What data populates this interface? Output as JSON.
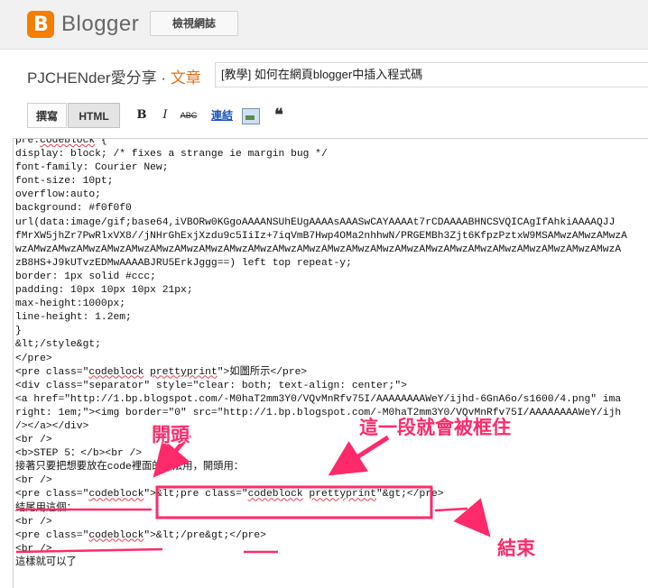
{
  "header": {
    "logo_letter": "B",
    "logo_text": "Blogger",
    "view_blog_label": "檢視網誌"
  },
  "blog": {
    "name": "PJCHENder愛分享",
    "separator": " · ",
    "section": "文章"
  },
  "post": {
    "title_value": "[教學] 如何在網頁blogger中插入程式碼"
  },
  "toolbar": {
    "compose_label": "撰寫",
    "html_label": "HTML",
    "bold_label": "B",
    "italic_label": "I",
    "strike_label": "ABC",
    "link_label": "連結",
    "quote_label": "❝"
  },
  "editor": {
    "lines": [
      "pre.codeblock {",
      "display: block; /* fixes a strange ie margin bug */",
      "font-family: Courier New;",
      "font-size: 10pt;",
      "overflow:auto;",
      "background: #f0f0f0",
      "url(data:image/gif;base64,iVBORw0KGgoAAAANSUhEUgAAAAsAAASwCAYAAAAt7rCDAAAABHNCSVQICAgIfAhkiAAAAQJJ",
      "fMrXW5jhZr7PwRlxVX8//jNHrGhExjXzdu9c5IiIz+7iqVmB7Hwp4OMa2nhhwN/PRGEMBh3Zjt6KfpzPztxW9MSAMwzAMwzAMwzA",
      "wzAMwzAMwzAMwzAMwzAMwzAMwzAMwzAMwzAMwzAMwzAMwzAMwzAMwzAMwzAMwzAMwzAMwzAMwzAMwzAMwzAMwzAMwzAMwzAMwzA",
      "zB8HS+J9kUTvzEDMwAAAABJRU5ErkJggg==) left top repeat-y;",
      "border: 1px solid #ccc;",
      "padding: 10px 10px 10px 21px;",
      "max-height:1000px;",
      "line-height: 1.2em;",
      "}",
      "&lt;/style&gt;",
      "</pre>",
      "<pre class=\"codeblock prettyprint\">如圖所示</pre>",
      "<div class=\"separator\" style=\"clear: both; text-align: center;\">",
      "<a href=\"http://1.bp.blogspot.com/-M0haT2mm3Y0/VQvMnRfv75I/AAAAAAAAWeY/ijhd-6GnA6o/s1600/4.png\" ima",
      "right: 1em;\"><img border=\"0\" src=\"http://1.bp.blogspot.com/-M0haT2mm3Y0/VQvMnRfv75I/AAAAAAAAWeY/ijh",
      "/></a></div>",
      "<br />",
      "<b>STEP 5：</b><br />",
      "接著只要把想要放在code裡面的語法用，開頭用：",
      "<br />",
      "<pre class=\"codeblock\">&lt;pre class=\"codeblock prettyprint\"&gt;</pre>",
      "結尾用這個：",
      "<br />",
      "<pre class=\"codeblock\">&lt;/pre&gt;</pre>",
      "<br />",
      "這樣就可以了"
    ]
  },
  "annotations": {
    "start_label": "開頭",
    "boxed_label": "這一段就會被框住",
    "end_label": "結束",
    "accent_color": "#ff2a6a"
  }
}
